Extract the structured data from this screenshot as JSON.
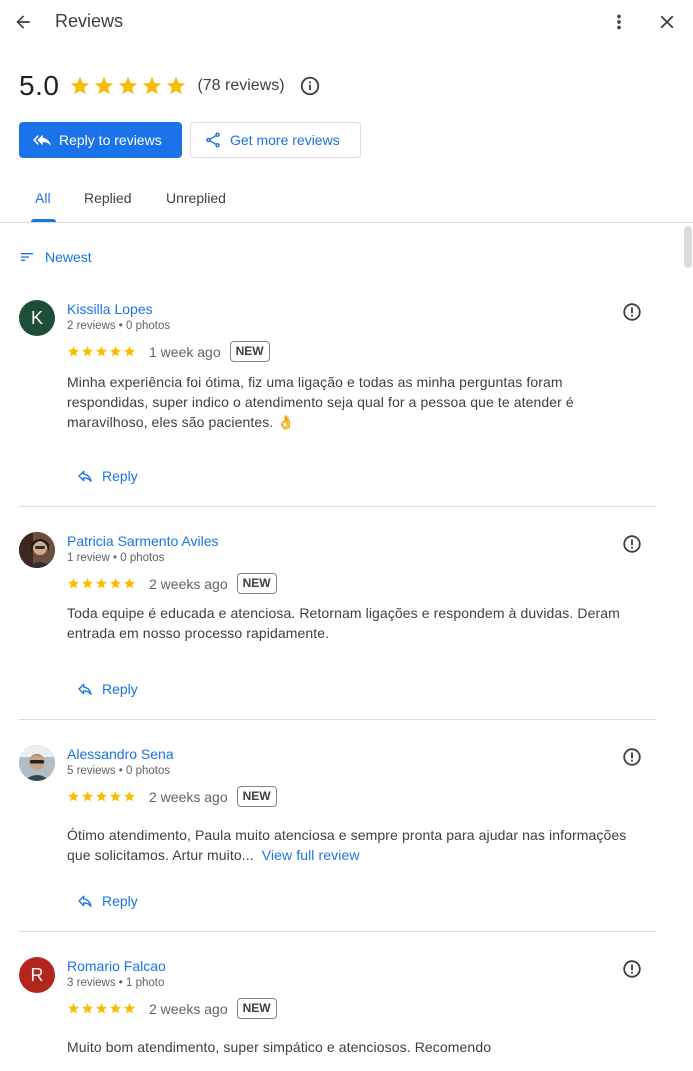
{
  "header": {
    "title": "Reviews"
  },
  "summary": {
    "rating": "5.0",
    "count_text": "(78 reviews)"
  },
  "actions": {
    "reply_label": "Reply to reviews",
    "get_more_label": "Get more reviews"
  },
  "tabs": [
    {
      "label": "All"
    },
    {
      "label": "Replied"
    },
    {
      "label": "Unreplied"
    }
  ],
  "active_tab": "All",
  "sort": {
    "label": "Newest"
  },
  "reply_label": "Reply",
  "colors": {
    "accent": "#1a73e8",
    "star": "#fbbc04",
    "badge_border": "#80868b"
  },
  "reviews": [
    {
      "initial": "K",
      "avatar_color": "#1e4d3a",
      "name": "Kissilla Lopes",
      "meta": "2 reviews • 0 photos",
      "stars": 5,
      "date": "1 week ago",
      "badge": "NEW",
      "text": "Minha experiência foi ótima, fiz uma ligação e todas as minha perguntas foram respondidas, super indico o atendimento seja qual for a pessoa que te atender é maravilhoso, eles são pacientes. 👌"
    },
    {
      "initial": "",
      "avatar_color": "#6d4c41",
      "name": "Patricia Sarmento Aviles",
      "meta": "1 review • 0 photos",
      "stars": 5,
      "date": "2 weeks ago",
      "badge": "NEW",
      "text": "Toda equipe é educada e atenciosa. Retornam ligações e respondem à duvidas. Deram entrada em nosso processo rapidamente."
    },
    {
      "initial": "",
      "avatar_color": "#9e9e9e",
      "name": "Alessandro Sena",
      "meta": "5 reviews • 0 photos",
      "stars": 5,
      "date": "2 weeks ago",
      "badge": "NEW",
      "text": "Ótimo atendimento, Paula muito atenciosa e sempre pronta para ajudar nas informações que solicitamos. Artur muito...",
      "more_label": "View full review"
    },
    {
      "initial": "R",
      "avatar_color": "#b3261e",
      "name": "Romario Falcao",
      "meta": "3 reviews • 1 photo",
      "stars": 5,
      "date": "2 weeks ago",
      "badge": "NEW",
      "text": "Muito bom atendimento, super simpático e atenciosos. Recomendo"
    }
  ]
}
